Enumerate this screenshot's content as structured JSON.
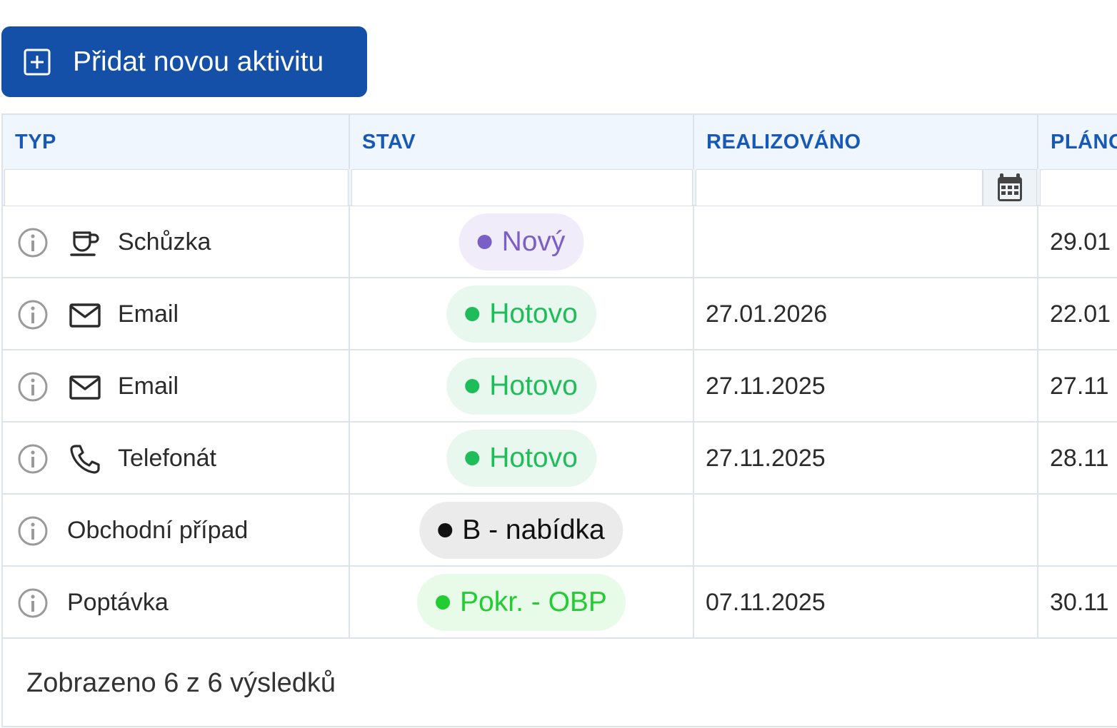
{
  "toolbar": {
    "add_label": "Přidat novou aktivitu"
  },
  "columns": [
    {
      "key": "typ",
      "label": "TYP"
    },
    {
      "key": "stav",
      "label": "STAV"
    },
    {
      "key": "realizovano",
      "label": "REALIZOVÁNO"
    },
    {
      "key": "planovano",
      "label": "PLÁNOVÁNO"
    }
  ],
  "filters": {
    "typ": "",
    "stav": "",
    "realizovano": "",
    "planovano": ""
  },
  "rows": [
    {
      "type_icon": "coffee-cup-icon",
      "type": "Schůzka",
      "status": "Nový",
      "status_color": "#7b5fc7",
      "status_bg": "#f1ecfa",
      "realized": "",
      "planned": "29.01"
    },
    {
      "type_icon": "envelope-icon",
      "type": "Email",
      "status": "Hotovo",
      "status_color": "#1fbd5a",
      "status_bg": "#e9f8ef",
      "realized": "27.01.2026",
      "planned": "22.01"
    },
    {
      "type_icon": "envelope-icon",
      "type": "Email",
      "status": "Hotovo",
      "status_color": "#1fbd5a",
      "status_bg": "#e9f8ef",
      "realized": "27.11.2025",
      "planned": "27.11"
    },
    {
      "type_icon": "phone-icon",
      "type": "Telefonát",
      "status": "Hotovo",
      "status_color": "#1fbd5a",
      "status_bg": "#e9f8ef",
      "realized": "27.11.2025",
      "planned": "28.11"
    },
    {
      "type_icon": "",
      "type": "Obchodní případ",
      "status": "B - nabídka",
      "status_color": "#111111",
      "status_bg": "#ebebeb",
      "realized": "",
      "planned": ""
    },
    {
      "type_icon": "",
      "type": "Poptávka",
      "status": "Pokr. - OBP",
      "status_color": "#22cc33",
      "status_bg": "#e8fbe9",
      "realized": "07.11.2025",
      "planned": "30.11"
    }
  ],
  "footer": {
    "summary": "Zobrazeno 6 z 6 výsledků"
  },
  "colors": {
    "primary": "#1450a8",
    "header_text": "#1659b8",
    "header_bg": "#f0f6fd"
  }
}
